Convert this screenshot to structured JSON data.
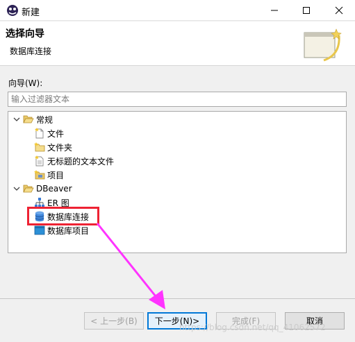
{
  "window": {
    "title": "新建"
  },
  "header": {
    "title": "选择向导",
    "subtitle": "数据库连接"
  },
  "wizard": {
    "label": "向导(W):"
  },
  "filter": {
    "placeholder": "输入过滤器文本"
  },
  "tree": {
    "groups": [
      {
        "label": "常规",
        "expanded": true,
        "items": [
          "文件",
          "文件夹",
          "无标题的文本文件",
          "项目"
        ]
      },
      {
        "label": "DBeaver",
        "expanded": true,
        "items": [
          "ER 图",
          "数据库连接",
          "数据库项目"
        ]
      }
    ],
    "selected": "数据库连接"
  },
  "buttons": {
    "back": "< 上一步(B)",
    "next": "下一步(N)>",
    "finish": "完成(F)",
    "cancel": "取消"
  },
  "watermark": "https://blog.csdn.net/qq_41062572",
  "colors": {
    "highlight": "#ee2233",
    "arrow": "#ff33ff",
    "accent": "#0078d7"
  }
}
